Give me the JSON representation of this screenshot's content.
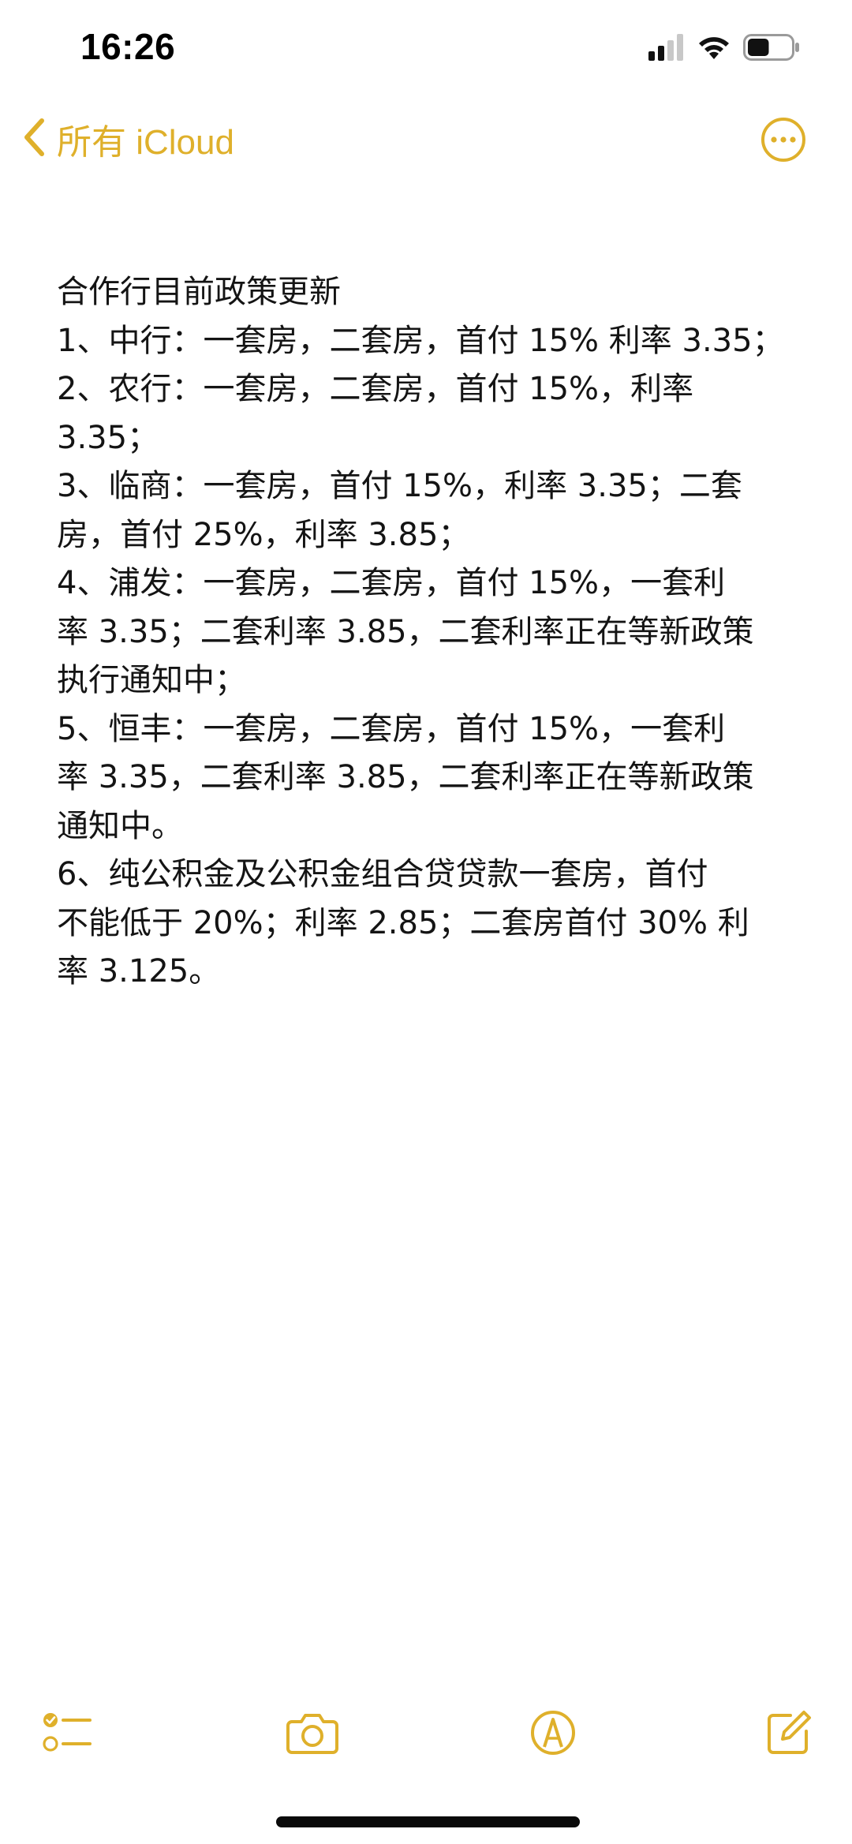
{
  "status_bar": {
    "time": "16:26",
    "battery_level": 0.5,
    "icons": [
      "cellular-signal-icon",
      "wifi-icon",
      "battery-icon"
    ]
  },
  "nav": {
    "back_label": "所有 iCloud",
    "back_icon": "chevron-left-icon",
    "more_icon": "ellipsis-circle-icon"
  },
  "note": {
    "lines": [
      "合作行目前政策更新",
      "1、中行：一套房，二套房，首付 15% 利率 3.35；",
      "2、农行：一套房，二套房，首付 15%，利率",
      "3.35；",
      "3、临商：一套房，首付 15%，利率 3.35；二套",
      "房，首付 25%，利率 3.85；",
      "4、浦发：一套房，二套房，首付 15%，一套利",
      "率 3.35；二套利率 3.85，二套利率正在等新政策",
      "执行通知中；",
      "5、恒丰：一套房，二套房，首付 15%，一套利",
      "率 3.35，二套利率 3.85，二套利率正在等新政策",
      "通知中。",
      "6、纯公积金及公积金组合贷贷款一套房，首付",
      "不能低于 20%；利率 2.85；二套房首付 30% 利",
      "率 3.125。"
    ]
  },
  "toolbar": {
    "items": [
      "checklist-icon",
      "camera-icon",
      "markup-pen-icon",
      "compose-icon"
    ]
  },
  "colors": {
    "accent": "#DFB02B",
    "text": "#141414",
    "background": "#FFFFFF"
  }
}
